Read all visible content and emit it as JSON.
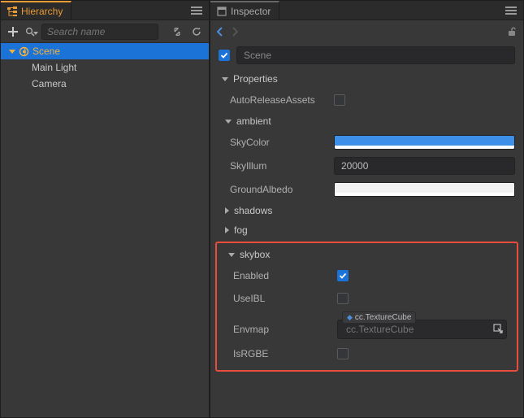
{
  "hierarchy": {
    "tab_title": "Hierarchy",
    "search_placeholder": "Search name",
    "tree": {
      "root": "Scene",
      "children": [
        "Main Light",
        "Camera"
      ]
    }
  },
  "inspector": {
    "tab_title": "Inspector",
    "node_name": "Scene",
    "node_enabled": true,
    "sections": {
      "properties_label": "Properties",
      "ambient_label": "ambient",
      "shadows_label": "shadows",
      "fog_label": "fog",
      "skybox_label": "skybox"
    },
    "properties": {
      "auto_release_label": "AutoReleaseAssets",
      "auto_release_value": false
    },
    "ambient": {
      "sky_color_label": "SkyColor",
      "sky_illum_label": "SkyIllum",
      "sky_illum_value": "20000",
      "ground_albedo_label": "GroundAlbedo"
    },
    "skybox": {
      "enabled_label": "Enabled",
      "enabled_value": true,
      "useibl_label": "UseIBL",
      "useibl_value": false,
      "envmap_label": "Envmap",
      "envmap_type": "cc.TextureCube",
      "envmap_placeholder": "cc.TextureCube",
      "isrgbe_label": "IsRGBE",
      "isrgbe_value": false
    }
  }
}
